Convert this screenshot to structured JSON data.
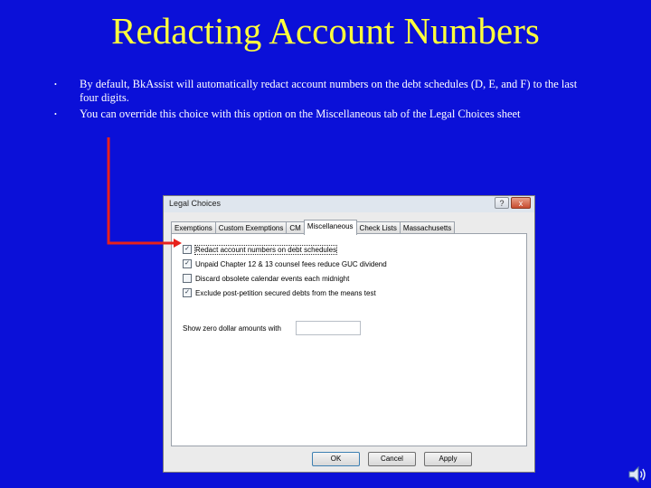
{
  "slide": {
    "title": "Redacting Account Numbers",
    "bullets": [
      "By default, BkAssist will automatically redact account numbers on the debt schedules (D, E, and F) to the last four digits.",
      "You can override this choice with this option on the Miscellaneous tab of the Legal Choices sheet"
    ],
    "bullet_glyph": "•",
    "colors": {
      "background": "#0b10d8",
      "title": "#ffff3c",
      "text": "#ffffff",
      "arrow": "#e8211b"
    }
  },
  "dialog": {
    "title": "Legal Choices",
    "title_buttons": {
      "help": "?",
      "close": "x"
    },
    "tabs": [
      {
        "label": "Exemptions",
        "active": false
      },
      {
        "label": "Custom Exemptions",
        "active": false
      },
      {
        "label": "CM",
        "active": false
      },
      {
        "label": "Miscellaneous",
        "active": true
      },
      {
        "label": "Check Lists",
        "active": false
      },
      {
        "label": "Massachusetts",
        "active": false
      }
    ],
    "options": [
      {
        "label": "Redact account numbers on debt schedules",
        "checked": true,
        "focused": true
      },
      {
        "label": "Unpaid Chapter 12 & 13 counsel fees reduce GUC dividend",
        "checked": true,
        "focused": false
      },
      {
        "label": "Discard obsolete calendar events each midnight",
        "checked": false,
        "focused": false
      },
      {
        "label": "Exclude post-petition secured debts from the means test",
        "checked": true,
        "focused": false
      }
    ],
    "zero_amounts": {
      "label": "Show zero dollar amounts with",
      "value": ""
    },
    "buttons": {
      "ok": "OK",
      "cancel": "Cancel",
      "apply": "Apply"
    }
  },
  "icons": {
    "sound": "speaker-icon",
    "check": "✓"
  }
}
